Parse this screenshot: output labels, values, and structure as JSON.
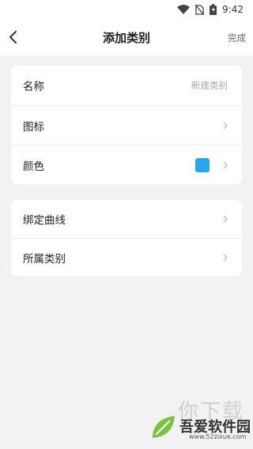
{
  "status_bar": {
    "time": "9:42",
    "icons": [
      "wifi-icon",
      "no-sim-icon",
      "battery-icon"
    ]
  },
  "header": {
    "title": "添加类别",
    "done_label": "完成",
    "back_icon": "chevron-left-icon"
  },
  "section1": {
    "name": {
      "label": "名称",
      "placeholder": "新建类别"
    },
    "icon": {
      "label": "图标"
    },
    "color": {
      "label": "颜色",
      "swatch": "#2aa6ef"
    }
  },
  "section2": {
    "curve": {
      "label": "绑定曲线"
    },
    "parent": {
      "label": "所属类别"
    }
  },
  "watermark": {
    "text": "你下载",
    "brand": "吾爱软件园",
    "url": "www.52zixue.com"
  },
  "colors": {
    "background": "#f2f2f4",
    "accent_swatch": "#2aa6ef"
  }
}
